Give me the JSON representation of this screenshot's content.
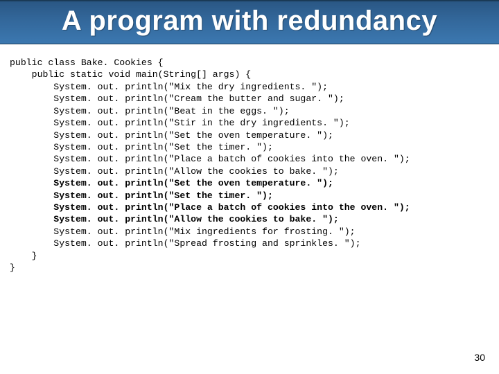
{
  "title": "A program with redundancy",
  "code": {
    "l1": "public class Bake. Cookies {",
    "l2": "    public static void main(String[] args) {",
    "l3": "        System. out. println(\"Mix the dry ingredients. \");",
    "l4": "        System. out. println(\"Cream the butter and sugar. \");",
    "l5": "        System. out. println(\"Beat in the eggs. \");",
    "l6": "        System. out. println(\"Stir in the dry ingredients. \");",
    "l7": "        System. out. println(\"Set the oven temperature. \");",
    "l8": "        System. out. println(\"Set the timer. \");",
    "l9": "        System. out. println(\"Place a batch of cookies into the oven. \");",
    "l10": "        System. out. println(\"Allow the cookies to bake. \");",
    "l11": "        System. out. println(\"Set the oven temperature. \");",
    "l12": "        System. out. println(\"Set the timer. \");",
    "l13": "        System. out. println(\"Place a batch of cookies into the oven. \");",
    "l14": "        System. out. println(\"Allow the cookies to bake. \");",
    "l15": "        System. out. println(\"Mix ingredients for frosting. \");",
    "l16": "        System. out. println(\"Spread frosting and sprinkles. \");",
    "l17": "    }",
    "l18": "}"
  },
  "page_number": "30"
}
